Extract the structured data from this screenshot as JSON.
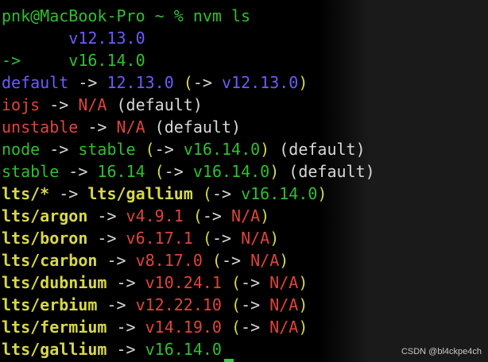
{
  "colors": {
    "text": "#d8d8d8",
    "green": "#2fbf2f",
    "blue": "#6a5cff",
    "red": "#e0443a",
    "yellow": "#d8d84a",
    "cursor": "#2ecc40"
  },
  "top_cut_text": "pnk@MacBook-Pro ~ % nvm ls",
  "lines": [
    [
      {
        "text": "pnk@MacBook-Pro ~ % nvm ls",
        "c": "green"
      }
    ],
    [
      {
        "text": "       v12.13.0",
        "c": "blue"
      }
    ],
    [
      {
        "text": "->     v16.14.0",
        "c": "green"
      }
    ],
    [
      {
        "text": "default",
        "c": "blue"
      },
      {
        "text": " -> ",
        "c": "text"
      },
      {
        "text": "12.13.0",
        "c": "blue"
      },
      {
        "text": " (",
        "c": "yellow"
      },
      {
        "text": "->",
        "c": "text"
      },
      {
        "text": " v12.13.0",
        "c": "blue"
      },
      {
        "text": ")",
        "c": "yellow"
      }
    ],
    [
      {
        "text": "iojs",
        "c": "red"
      },
      {
        "text": " -> ",
        "c": "text"
      },
      {
        "text": "N/A",
        "c": "red"
      },
      {
        "text": " (default)",
        "c": "text"
      }
    ],
    [
      {
        "text": "unstable",
        "c": "red"
      },
      {
        "text": " -> ",
        "c": "text"
      },
      {
        "text": "N/A",
        "c": "red"
      },
      {
        "text": " (default)",
        "c": "text"
      }
    ],
    [
      {
        "text": "node",
        "c": "green"
      },
      {
        "text": " -> ",
        "c": "text"
      },
      {
        "text": "stable",
        "c": "green"
      },
      {
        "text": " (",
        "c": "yellow"
      },
      {
        "text": "->",
        "c": "text"
      },
      {
        "text": " v16.14.0",
        "c": "green"
      },
      {
        "text": ")",
        "c": "yellow"
      },
      {
        "text": " (default)",
        "c": "text"
      }
    ],
    [
      {
        "text": "stable",
        "c": "green"
      },
      {
        "text": " -> ",
        "c": "text"
      },
      {
        "text": "16.14",
        "c": "green"
      },
      {
        "text": " (",
        "c": "yellow"
      },
      {
        "text": "->",
        "c": "text"
      },
      {
        "text": " v16.14.0",
        "c": "green"
      },
      {
        "text": ")",
        "c": "yellow"
      },
      {
        "text": " (default)",
        "c": "text"
      }
    ],
    [
      {
        "text": "lts/*",
        "c": "yellow",
        "b": true
      },
      {
        "text": " -> ",
        "c": "text"
      },
      {
        "text": "lts/gallium",
        "c": "yellow",
        "b": true
      },
      {
        "text": " (",
        "c": "yellow"
      },
      {
        "text": "->",
        "c": "text"
      },
      {
        "text": " v16.14.0",
        "c": "green"
      },
      {
        "text": ")",
        "c": "yellow"
      }
    ],
    [
      {
        "text": "lts/argon",
        "c": "yellow",
        "b": true
      },
      {
        "text": " -> ",
        "c": "text"
      },
      {
        "text": "v4.9.1",
        "c": "red"
      },
      {
        "text": " (",
        "c": "yellow"
      },
      {
        "text": "->",
        "c": "text"
      },
      {
        "text": " N/A",
        "c": "red"
      },
      {
        "text": ")",
        "c": "yellow"
      }
    ],
    [
      {
        "text": "lts/boron",
        "c": "yellow",
        "b": true
      },
      {
        "text": " -> ",
        "c": "text"
      },
      {
        "text": "v6.17.1",
        "c": "red"
      },
      {
        "text": " (",
        "c": "yellow"
      },
      {
        "text": "->",
        "c": "text"
      },
      {
        "text": " N/A",
        "c": "red"
      },
      {
        "text": ")",
        "c": "yellow"
      }
    ],
    [
      {
        "text": "lts/carbon",
        "c": "yellow",
        "b": true
      },
      {
        "text": " -> ",
        "c": "text"
      },
      {
        "text": "v8.17.0",
        "c": "red"
      },
      {
        "text": " (",
        "c": "yellow"
      },
      {
        "text": "->",
        "c": "text"
      },
      {
        "text": " N/A",
        "c": "red"
      },
      {
        "text": ")",
        "c": "yellow"
      }
    ],
    [
      {
        "text": "lts/dubnium",
        "c": "yellow",
        "b": true
      },
      {
        "text": " -> ",
        "c": "text"
      },
      {
        "text": "v10.24.1",
        "c": "red"
      },
      {
        "text": " (",
        "c": "yellow"
      },
      {
        "text": "->",
        "c": "text"
      },
      {
        "text": " N/A",
        "c": "red"
      },
      {
        "text": ")",
        "c": "yellow"
      }
    ],
    [
      {
        "text": "lts/erbium",
        "c": "yellow",
        "b": true
      },
      {
        "text": " -> ",
        "c": "text"
      },
      {
        "text": "v12.22.10",
        "c": "red"
      },
      {
        "text": " (",
        "c": "yellow"
      },
      {
        "text": "->",
        "c": "text"
      },
      {
        "text": " N/A",
        "c": "red"
      },
      {
        "text": ")",
        "c": "yellow"
      }
    ],
    [
      {
        "text": "lts/fermium",
        "c": "yellow",
        "b": true
      },
      {
        "text": " -> ",
        "c": "text"
      },
      {
        "text": "v14.19.0",
        "c": "red"
      },
      {
        "text": " (",
        "c": "yellow"
      },
      {
        "text": "->",
        "c": "text"
      },
      {
        "text": " N/A",
        "c": "red"
      },
      {
        "text": ")",
        "c": "yellow"
      }
    ],
    [
      {
        "text": "lts/gallium",
        "c": "yellow",
        "b": true
      },
      {
        "text": " -> ",
        "c": "text"
      },
      {
        "text": "v16.14.0",
        "c": "green"
      }
    ]
  ],
  "watermark": "CSDN @bl4ckpe4ch"
}
